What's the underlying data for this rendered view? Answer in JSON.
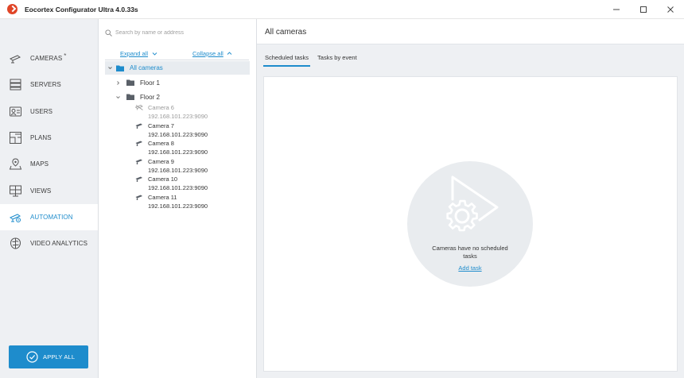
{
  "window": {
    "title": "Eocortex Configurator Ultra 4.0.33s"
  },
  "sidebar": {
    "items": [
      {
        "label": "CAMERAS",
        "icon": "camera-icon",
        "modified_marker": "*",
        "active": false
      },
      {
        "label": "SERVERS",
        "icon": "servers-icon",
        "active": false
      },
      {
        "label": "USERS",
        "icon": "users-icon",
        "active": false
      },
      {
        "label": "PLANS",
        "icon": "plans-icon",
        "active": false
      },
      {
        "label": "MAPS",
        "icon": "maps-icon",
        "active": false
      },
      {
        "label": "VIEWS",
        "icon": "views-icon",
        "active": false
      },
      {
        "label": "AUTOMATION",
        "icon": "automation-icon",
        "active": true
      },
      {
        "label": "VIDEO ANALYTICS",
        "icon": "video-analytics-icon",
        "active": false
      }
    ],
    "apply_label": "APPLY ALL"
  },
  "tree": {
    "search_placeholder": "Search by name or address",
    "expand_all": "Expand all",
    "collapse_all": "Collapse all",
    "root_label": "All cameras",
    "groups": [
      {
        "label": "Floor 1",
        "expanded": false
      },
      {
        "label": "Floor 2",
        "expanded": true
      }
    ],
    "cameras": [
      {
        "name": "Camera 6",
        "address": "192.168.101.223:9090",
        "disabled": true
      },
      {
        "name": "Camera 7",
        "address": "192.168.101.223:9090",
        "disabled": false
      },
      {
        "name": "Camera 8",
        "address": "192.168.101.223:9090",
        "disabled": false
      },
      {
        "name": "Camera 9",
        "address": "192.168.101.223:9090",
        "disabled": false
      },
      {
        "name": "Camera 10",
        "address": "192.168.101.223:9090",
        "disabled": false
      },
      {
        "name": "Camera 11",
        "address": "192.168.101.223:9090",
        "disabled": false
      }
    ]
  },
  "main": {
    "title": "All cameras",
    "tabs": [
      {
        "label": "Scheduled tasks",
        "active": true
      },
      {
        "label": "Tasks by event",
        "active": false
      }
    ],
    "empty_message": "Cameras have no scheduled tasks",
    "add_task_label": "Add task"
  },
  "colors": {
    "accent": "#1e8ccc",
    "logo": "#e04527",
    "sidebar_bg": "#eef0f3"
  }
}
